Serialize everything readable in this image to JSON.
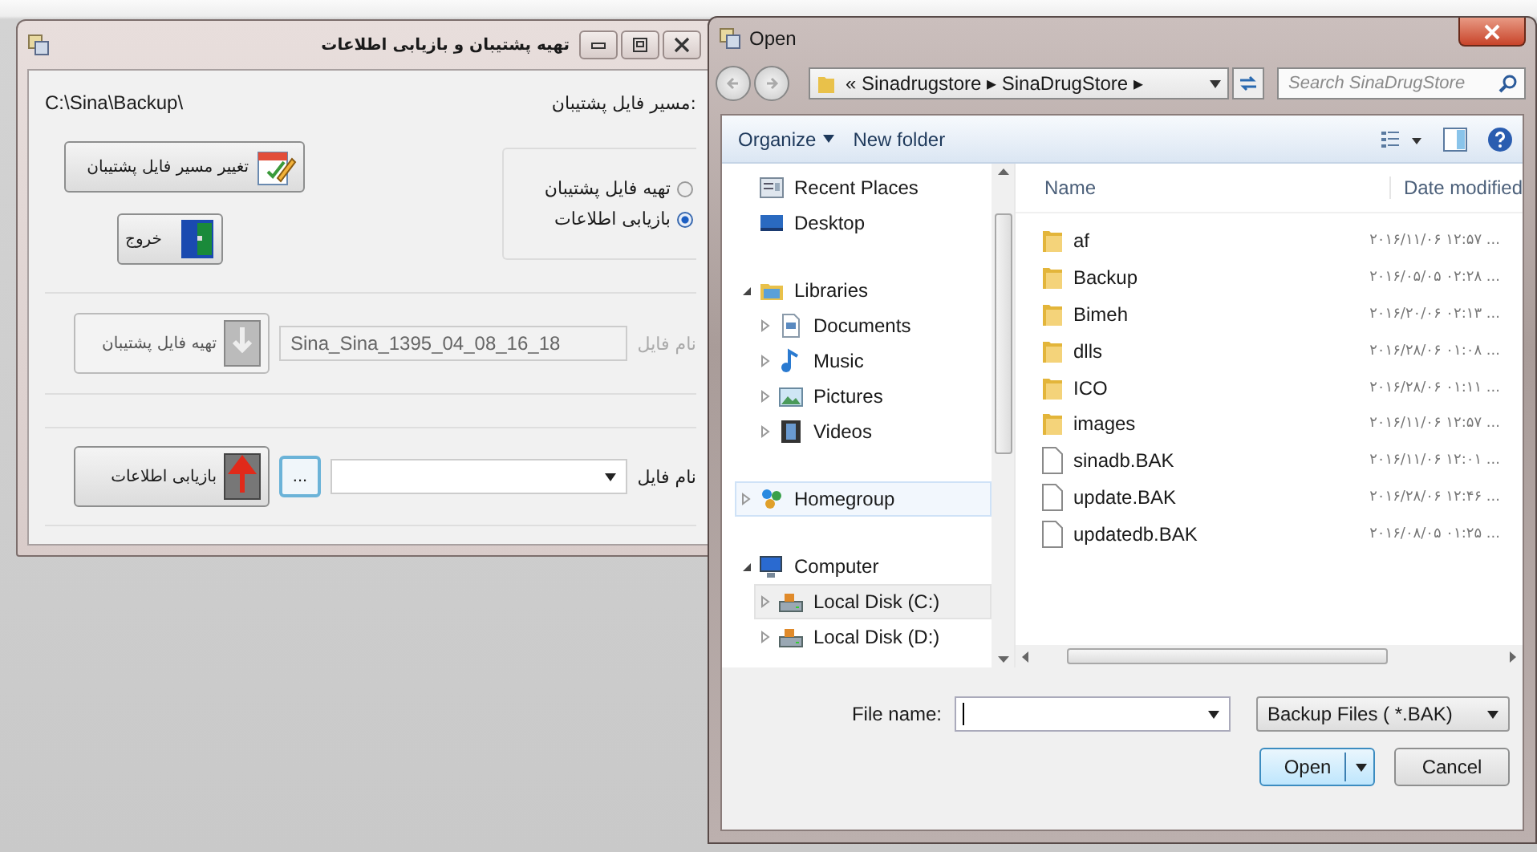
{
  "main_window": {
    "title": "تهیه پشتیبان و بازیابی اطلاعات",
    "path_label": "مسیر فایل پشتیبان:",
    "path_value": "C:\\Sina\\Backup\\",
    "change_path_button": "تغییر مسیر فایل پشتیبان",
    "exit_button": "خروج",
    "mode_options": [
      {
        "label": "تهیه فایل پشتیبان",
        "selected": false
      },
      {
        "label": "بازیابی اطلاعات",
        "selected": true
      }
    ],
    "backup_section": {
      "disabled": true,
      "file_label": "نام فایل",
      "file_value": "Sina_Sina_1395_04_08_16_18",
      "button": "تهیه فایل پشتیبان"
    },
    "restore_section": {
      "disabled": false,
      "file_label": "نام فایل",
      "browse_button": "...",
      "button": "بازیابی اطلاعات"
    }
  },
  "open_dialog": {
    "title": "Open",
    "breadcrumb": "« Sinadrugstore ▸ SinaDrugStore ▸",
    "search": {
      "placeholder": "Search SinaDrugStore"
    },
    "toolbar": {
      "organize": "Organize",
      "new_folder": "New folder"
    },
    "nav": [
      {
        "kind": "recent",
        "label": "Recent Places",
        "selected": false
      },
      {
        "kind": "desktop",
        "label": "Desktop",
        "selected": false
      },
      {
        "kind": "library",
        "label": "Libraries",
        "selected": false,
        "expanded": true,
        "children": [
          {
            "kind": "document",
            "label": "Documents",
            "selected": false,
            "expanded": false
          },
          {
            "kind": "music",
            "label": "Music",
            "selected": false,
            "expanded": false
          },
          {
            "kind": "pictures",
            "label": "Pictures",
            "selected": false,
            "expanded": false
          },
          {
            "kind": "videos",
            "label": "Videos",
            "selected": false,
            "expanded": false
          }
        ]
      },
      {
        "kind": "homegroup",
        "label": "Homegroup",
        "selected": true,
        "expanded": false
      },
      {
        "kind": "computer",
        "label": "Computer",
        "selected": false,
        "expanded": true,
        "children": [
          {
            "kind": "drive",
            "label": "Local Disk (C:)",
            "selected": false,
            "hovered": true,
            "expanded": false
          },
          {
            "kind": "drive",
            "label": "Local Disk (D:)",
            "selected": false,
            "expanded": false
          }
        ]
      }
    ],
    "name_column": "Name",
    "date_column": "Date modified",
    "files": [
      {
        "kind": "folder",
        "name": "af",
        "date": "۲۰۱۶/۱۱/۰۶ ۱۲:۵۷ ..."
      },
      {
        "kind": "folder",
        "name": "Backup",
        "date": "۲۰۱۶/۰۵/۰۵ ۰۲:۲۸ ..."
      },
      {
        "kind": "folder",
        "name": "Bimeh",
        "date": "۲۰۱۶/۲۰/۰۶ ۰۲:۱۳ ..."
      },
      {
        "kind": "folder",
        "name": "dlls",
        "date": "۲۰۱۶/۲۸/۰۶ ۰۱:۰۸ ..."
      },
      {
        "kind": "folder",
        "name": "ICO",
        "date": "۲۰۱۶/۲۸/۰۶ ۰۱:۱۱ ..."
      },
      {
        "kind": "folder",
        "name": "images",
        "date": "۲۰۱۶/۱۱/۰۶ ۱۲:۵۷ ..."
      },
      {
        "kind": "file",
        "name": "sinadb.BAK",
        "date": "۲۰۱۶/۱۱/۰۶ ۱۲:۰۱ ..."
      },
      {
        "kind": "file",
        "name": "update.BAK",
        "date": "۲۰۱۶/۲۸/۰۶ ۱۲:۴۶ ..."
      },
      {
        "kind": "file",
        "name": "updatedb.BAK",
        "date": "۲۰۱۶/۰۸/۰۵ ۰۱:۲۵ ..."
      }
    ],
    "file_name_label": "File name:",
    "file_type": "Backup Files ( *.BAK)",
    "open_button": "Open",
    "cancel_button": "Cancel"
  }
}
